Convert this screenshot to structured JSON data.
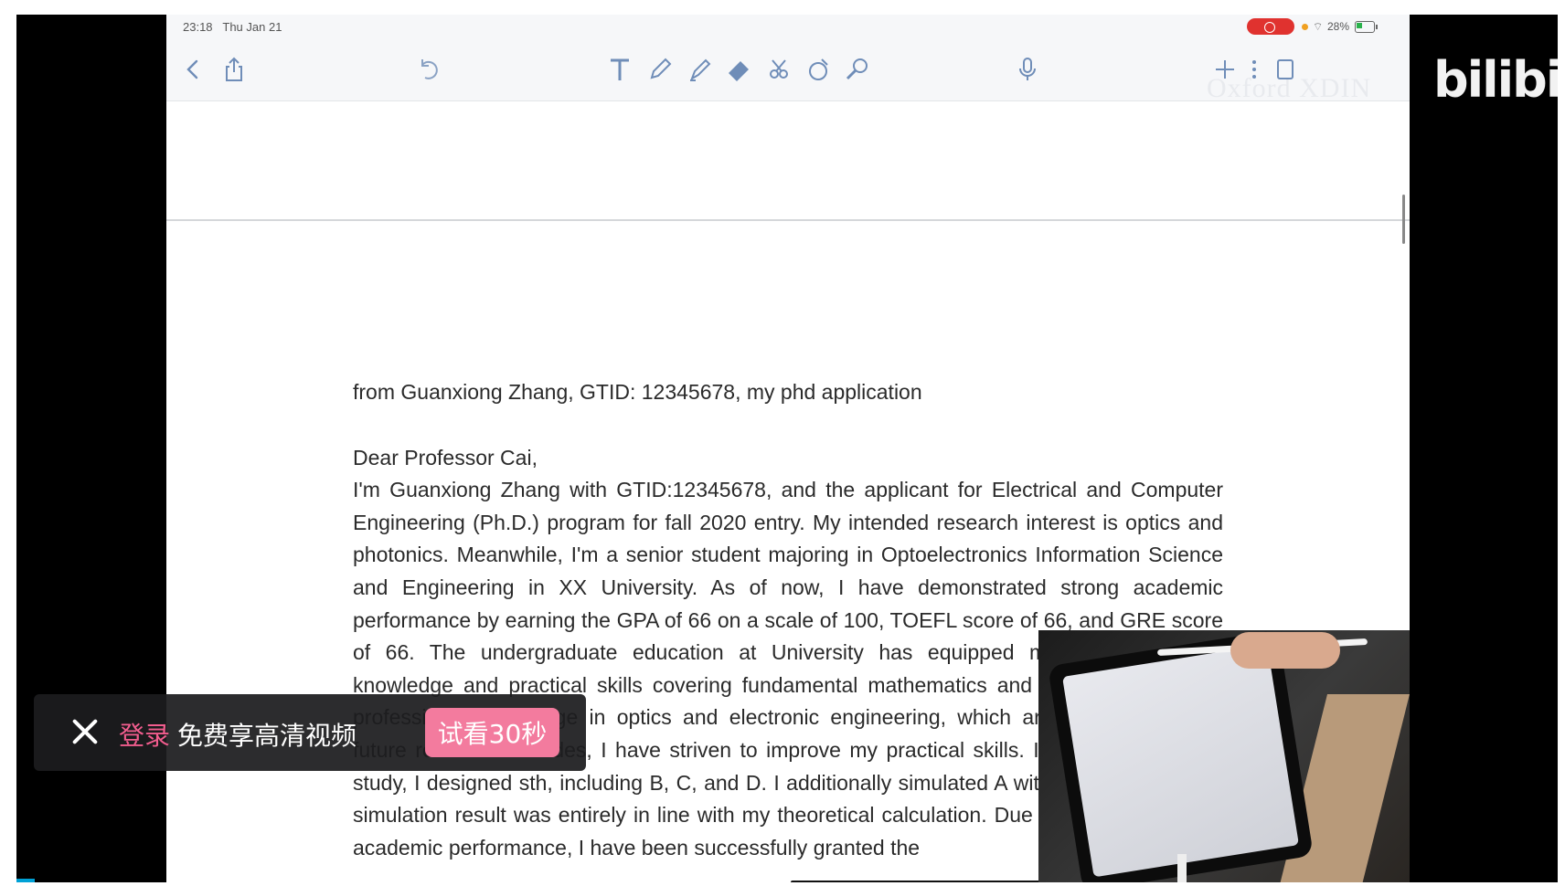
{
  "status_bar": {
    "time": "23:18",
    "date": "Thu Jan 21",
    "battery": "28%"
  },
  "toolbar": {
    "icons": [
      "back-icon",
      "share-icon",
      "undo-icon",
      "text-tool-icon",
      "pen-icon",
      "highlighter-icon",
      "eraser-icon",
      "lasso-icon",
      "shapes-icon",
      "zoom-icon",
      "microphone-icon",
      "add-page-icon",
      "more-icon",
      "pages-icon"
    ],
    "watermark": "Oxford XDIN"
  },
  "document": {
    "from_line": "from Guanxiong Zhang, GTID: 12345678, my phd application",
    "greeting": "Dear Professor Cai,",
    "body": "I'm Guanxiong Zhang with GTID:12345678, and the applicant for Electrical and Computer Engineering (Ph.D.) program for fall 2020 entry. My intended research interest is optics and photonics. Meanwhile, I'm a senior student majoring in Optoelectronics Information Science and Engineering in XX University. As of now, I have demonstrated strong academic performance by earning the GPA of 66 on a scale of 100, TOEFL score of 66, and GRE score of 66. The undergraduate education at University has equipped me with theoretical knowledge and practical skills covering fundamental mathematics and physics as well as professional knowledge in optics and electronic engineering, which are essential for the future research. Besides, I have striven to improve my practical skills. In the course of my study, I designed sth, including B, C, and D. I additionally simulated A with the result that the simulation result was entirely in line with my theoretical calculation. Due to my extraordinary academic performance, I have been successfully granted the"
  },
  "brand": {
    "logo": "bilibili"
  },
  "login_bar": {
    "login_label": "登录",
    "message": "免费享高清视频",
    "trial_button": "试看30秒"
  },
  "colors": {
    "accent_pink": "#f25d8e",
    "button_pink": "#f37b9e",
    "toolbar_icon_blue": "#6f8db8",
    "record_red": "#e0322f"
  }
}
